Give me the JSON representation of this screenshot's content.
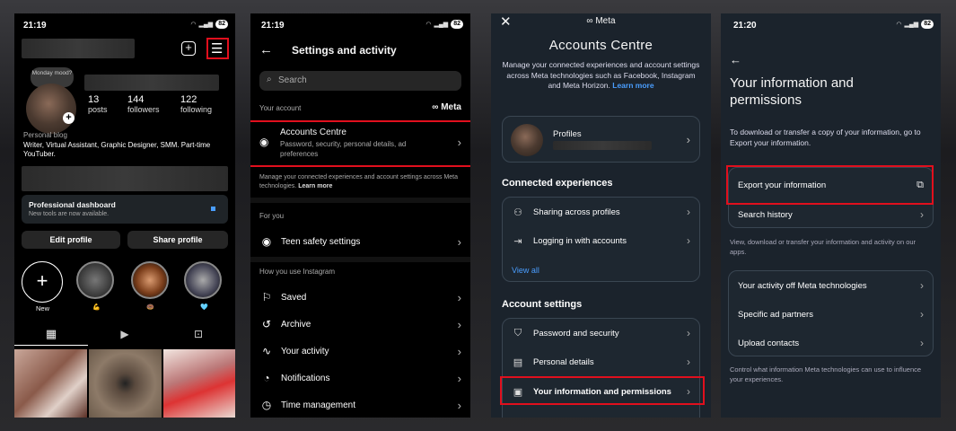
{
  "panel1": {
    "time": "21:19",
    "battery": "82",
    "note_bubble": "Monday mood?",
    "stats": [
      {
        "num": "13",
        "label": "posts"
      },
      {
        "num": "144",
        "label": "followers"
      },
      {
        "num": "122",
        "label": "following"
      }
    ],
    "bio_category": "Personal blog",
    "bio_text": "Writer, Virtual Assistant, Graphic Designer,  SMM. Part-time YouTuber.",
    "dashboard_title": "Professional dashboard",
    "dashboard_sub": "New tools are now available.",
    "edit_profile": "Edit profile",
    "share_profile": "Share profile",
    "new_label": "New",
    "highlight_emojis": [
      "💪",
      "🍩",
      "🩵"
    ]
  },
  "panel2": {
    "time": "21:19",
    "battery": "82",
    "title": "Settings and activity",
    "search_placeholder": "Search",
    "your_account": "Your account",
    "meta_logo": "∞ Meta",
    "accounts_centre": "Accounts Centre",
    "accounts_centre_sub": "Password, security, personal details, ad preferences",
    "manage_text": "Manage your connected experiences and account settings across Meta technologies.",
    "learn_more": "Learn more",
    "for_you": "For you",
    "teen_safety": "Teen safety settings",
    "how_you_use": "How you use Instagram",
    "items": [
      "Saved",
      "Archive",
      "Your activity",
      "Notifications",
      "Time management"
    ]
  },
  "panel3": {
    "meta_logo": "∞ Meta",
    "title": "Accounts Centre",
    "desc": "Manage your connected experiences and account settings across Meta technologies such as Facebook, Instagram and Meta Horizon.",
    "learn_more": "Learn more",
    "profiles": "Profiles",
    "connected_header": "Connected experiences",
    "sharing": "Sharing across profiles",
    "logging": "Logging in with accounts",
    "view_all": "View all",
    "account_settings_header": "Account settings",
    "password_security": "Password and security",
    "personal_details": "Personal details",
    "your_info": "Your information and permissions"
  },
  "panel4": {
    "time": "21:20",
    "battery": "82",
    "title": "Your information and permissions",
    "intro": "To download or transfer a copy of your information, go to Export your information.",
    "export": "Export your information",
    "search_history": "Search history",
    "view_text": "View, download or transfer your information and activity on our apps.",
    "activity_off": "Your activity off Meta technologies",
    "specific_ad": "Specific ad partners",
    "upload_contacts": "Upload contacts",
    "control_text": "Control what information Meta technologies can use to influence your experiences."
  },
  "colors": {
    "highlight_red": "#e10f1d",
    "meta_blue": "#4a9eff",
    "dark_panel": "#1b232c"
  }
}
